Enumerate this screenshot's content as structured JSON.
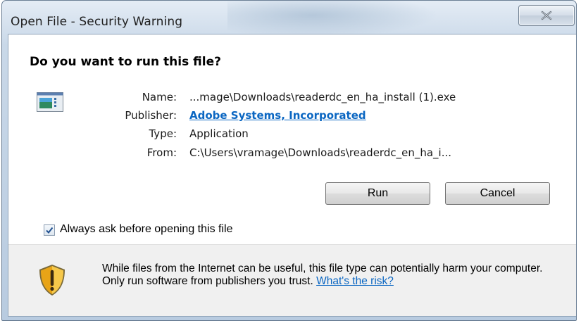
{
  "window": {
    "title": "Open File - Security Warning"
  },
  "dialog": {
    "heading": "Do you want to run this file?",
    "fields": [
      {
        "label": "Name:",
        "value": "...mage\\Downloads\\readerdc_en_ha_install (1).exe"
      },
      {
        "label": "Publisher:",
        "value": "Adobe Systems, Incorporated"
      },
      {
        "label": "Type:",
        "value": "Application"
      },
      {
        "label": "From:",
        "value": "C:\\Users\\vramage\\Downloads\\readerdc_en_ha_i..."
      }
    ],
    "buttons": {
      "run": "Run",
      "cancel": "Cancel"
    },
    "checkbox": {
      "label": "Always ask before opening this file",
      "checked": true
    },
    "warning": {
      "text": "While files from the Internet can be useful, this file type can potentially harm your computer. Only run software from publishers you trust.",
      "link": "What's the risk?"
    }
  },
  "icons": {
    "close": "close-icon",
    "app": "application-icon",
    "shield": "security-shield-icon",
    "checkmark": "checkmark-icon"
  },
  "colors": {
    "link": "#0a66c2",
    "shield_gold": "#e8a417"
  }
}
